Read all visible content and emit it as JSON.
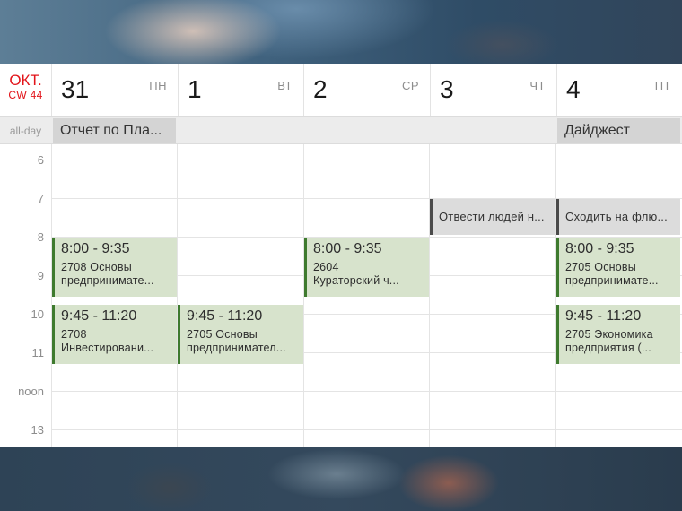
{
  "header": {
    "month": "ОКТ.",
    "week": "CW 44",
    "days": [
      {
        "num": "31",
        "name": "ПН"
      },
      {
        "num": "1",
        "name": "ВТ"
      },
      {
        "num": "2",
        "name": "СР"
      },
      {
        "num": "3",
        "name": "ЧТ"
      },
      {
        "num": "4",
        "name": "ПТ"
      }
    ]
  },
  "allday": {
    "label": "all-day",
    "events": [
      {
        "title": "Отчет по Пла..."
      },
      {
        "title": "Дайджест"
      }
    ]
  },
  "hours": [
    "6",
    "7",
    "8",
    "9",
    "10",
    "11",
    "noon",
    "13"
  ],
  "events": {
    "wed_reminder": "Отвести людей н...",
    "fri_reminder": "Сходить на флю...",
    "mon_1": {
      "time": "8:00 - 9:35",
      "line1": "2708 Основы",
      "line2": "предпринимате..."
    },
    "wed_1": {
      "time": "8:00 - 9:35",
      "line1": "2604",
      "line2": "Кураторский ч..."
    },
    "fri_1": {
      "time": "8:00 - 9:35",
      "line1": "2705 Основы",
      "line2": "предпринимате..."
    },
    "mon_2": {
      "time": "9:45 - 11:20",
      "line1": "2708",
      "line2": "Инвестировани..."
    },
    "tue_2": {
      "time": "9:45 - 11:20",
      "line1": "2705 Основы",
      "line2": "предпринимател..."
    },
    "fri_2": {
      "time": "9:45 - 11:20",
      "line1": "2705 Экономика",
      "line2": "предприятия (..."
    }
  },
  "colors": {
    "accent_red": "#e2141a",
    "event_green_bg": "#d7e3cc",
    "event_green_bar": "#3e7a2e",
    "reminder_gray_bg": "#dcdcdc"
  }
}
